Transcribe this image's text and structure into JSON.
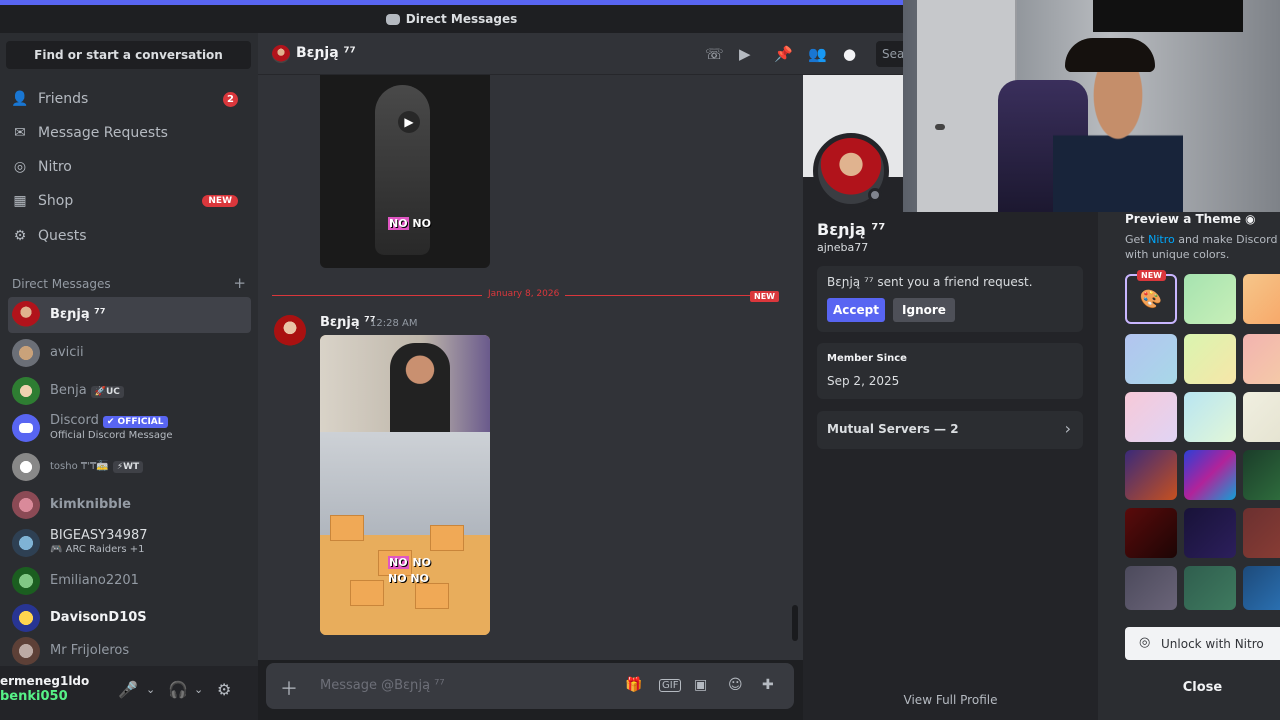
{
  "window": {
    "title": "Direct Messages"
  },
  "sidebar": {
    "search_label": "Find or start a conversation",
    "nav": [
      {
        "label": "Friends",
        "icon": "friends-icon",
        "badge": "2"
      },
      {
        "label": "Message Requests",
        "icon": "envelope-icon"
      },
      {
        "label": "Nitro",
        "icon": "nitro-icon"
      },
      {
        "label": "Shop",
        "icon": "shop-icon",
        "badge_new": "NEW"
      },
      {
        "label": "Quests",
        "icon": "quests-icon"
      }
    ],
    "dm_header": "Direct Messages",
    "dm_add": "+",
    "dms": [
      {
        "name": "Bεɲją ⁷⁷",
        "active": true
      },
      {
        "name": "avicii"
      },
      {
        "name": "Benja",
        "tag": "🚀UC"
      },
      {
        "name": "Discord",
        "tag": "✔ OFFICIAL",
        "sub": "Official Discord Message"
      },
      {
        "name": "tosho ₸'₸🚋",
        "tag": "⚡WT"
      },
      {
        "name": "kimknibble"
      },
      {
        "name": "BIGEASY34987",
        "sub": "🎮 ARC Raiders +1"
      },
      {
        "name": "Emiliano2201"
      },
      {
        "name": "DavisonD10S"
      },
      {
        "name": "Mr Frijoleros"
      }
    ],
    "user": {
      "name_top": "ermeneg1ldo",
      "name_bottom": "benki050"
    }
  },
  "chat": {
    "header_name": "Bεɲją ⁷⁷",
    "search_placeholder": "Sea",
    "caption_top": [
      "NO",
      "NO"
    ],
    "date_divider": "January 8, 2026",
    "new_label": "NEW",
    "message": {
      "author": "Bεɲją ⁷⁷",
      "time": "12:28 AM"
    },
    "caption_bottom": [
      "NO",
      "NO",
      "NO",
      "NO"
    ],
    "composer_placeholder": "Message @Bεɲją ⁷⁷"
  },
  "profile": {
    "display_name": "Bεɲją ⁷⁷",
    "username": "ajneba77",
    "friend_request": "Bεɲją ⁷⁷ sent you a friend request.",
    "accept_label": "Accept",
    "ignore_label": "Ignore",
    "member_since_label": "Member Since",
    "member_since_value": "Sep 2, 2025",
    "mutual_servers": "Mutual Servers — 2",
    "view_full_profile": "View Full Profile"
  },
  "theme": {
    "title": "Preview a Theme",
    "desc_prefix": "Get ",
    "desc_link": "Nitro",
    "desc_suffix": " and make Discord yo",
    "desc_line2": "with unique colors.",
    "new_badge": "NEW",
    "unlock_label": "Unlock with Nitro",
    "close_label": "Close"
  },
  "colors": {
    "brand": "#5865f2",
    "danger": "#da373c",
    "online_green": "#57f287"
  }
}
